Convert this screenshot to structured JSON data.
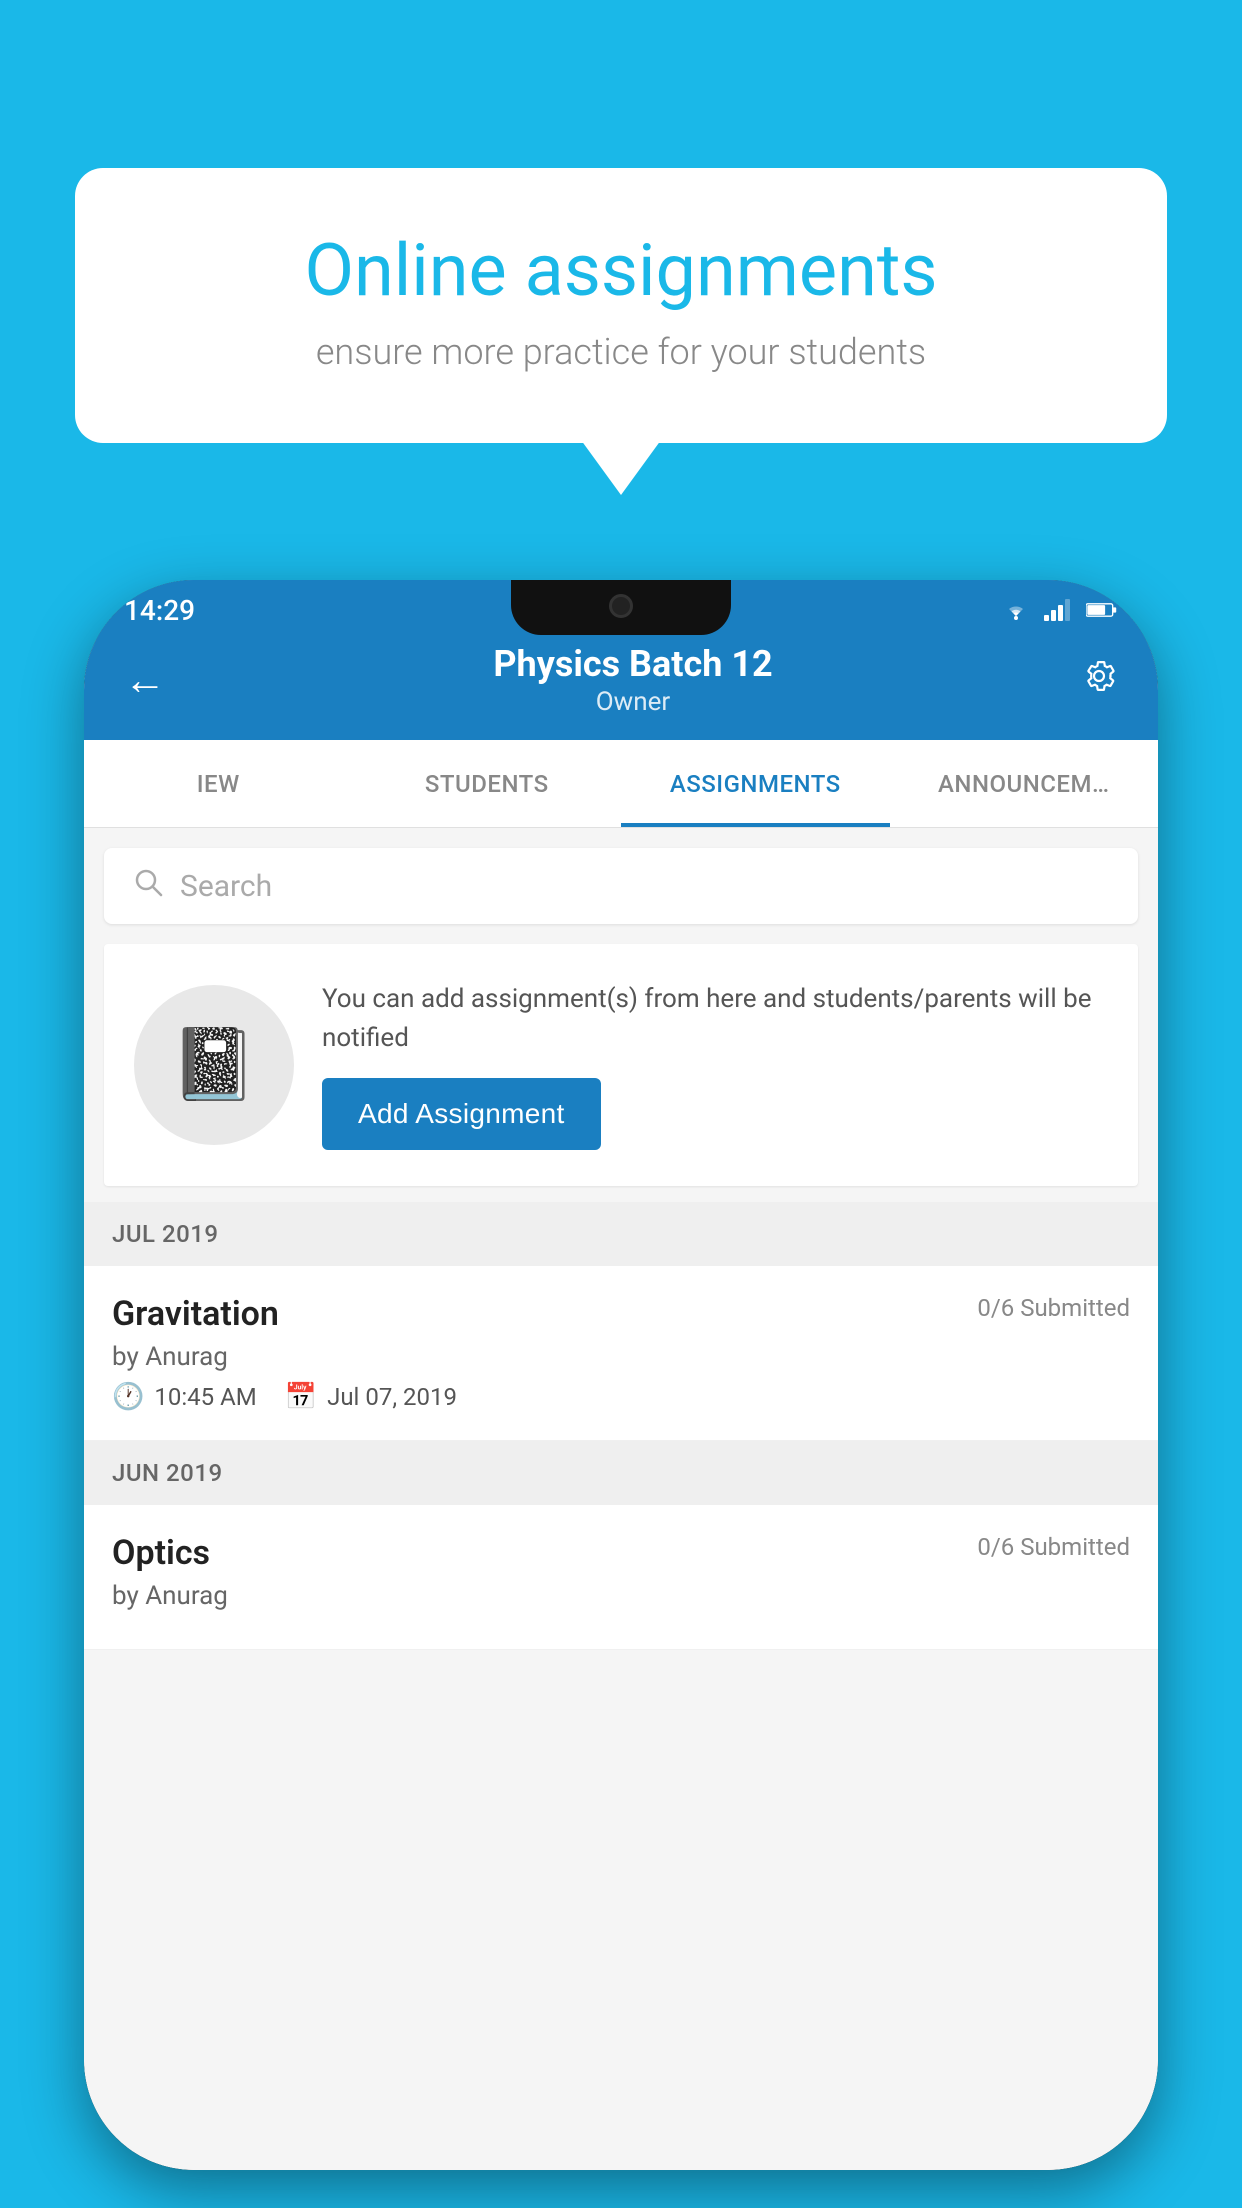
{
  "background_color": "#1ab8e8",
  "speech_bubble": {
    "title": "Online assignments",
    "subtitle": "ensure more practice for your students"
  },
  "phone": {
    "status_bar": {
      "time": "14:29"
    },
    "app_bar": {
      "title": "Physics Batch 12",
      "subtitle": "Owner",
      "back_label": "←",
      "settings_label": "⚙"
    },
    "tabs": [
      {
        "label": "IEW",
        "active": false
      },
      {
        "label": "STUDENTS",
        "active": false
      },
      {
        "label": "ASSIGNMENTS",
        "active": true
      },
      {
        "label": "ANNOUNCEM…",
        "active": false
      }
    ],
    "search": {
      "placeholder": "Search"
    },
    "empty_state": {
      "description": "You can add assignment(s) from here and students/parents will be notified",
      "button_label": "Add Assignment"
    },
    "sections": [
      {
        "header": "JUL 2019",
        "items": [
          {
            "name": "Gravitation",
            "submitted": "0/6 Submitted",
            "author": "by Anurag",
            "time": "10:45 AM",
            "date": "Jul 07, 2019"
          }
        ]
      },
      {
        "header": "JUN 2019",
        "items": [
          {
            "name": "Optics",
            "submitted": "0/6 Submitted",
            "author": "by Anurag",
            "time": "",
            "date": ""
          }
        ]
      }
    ]
  }
}
